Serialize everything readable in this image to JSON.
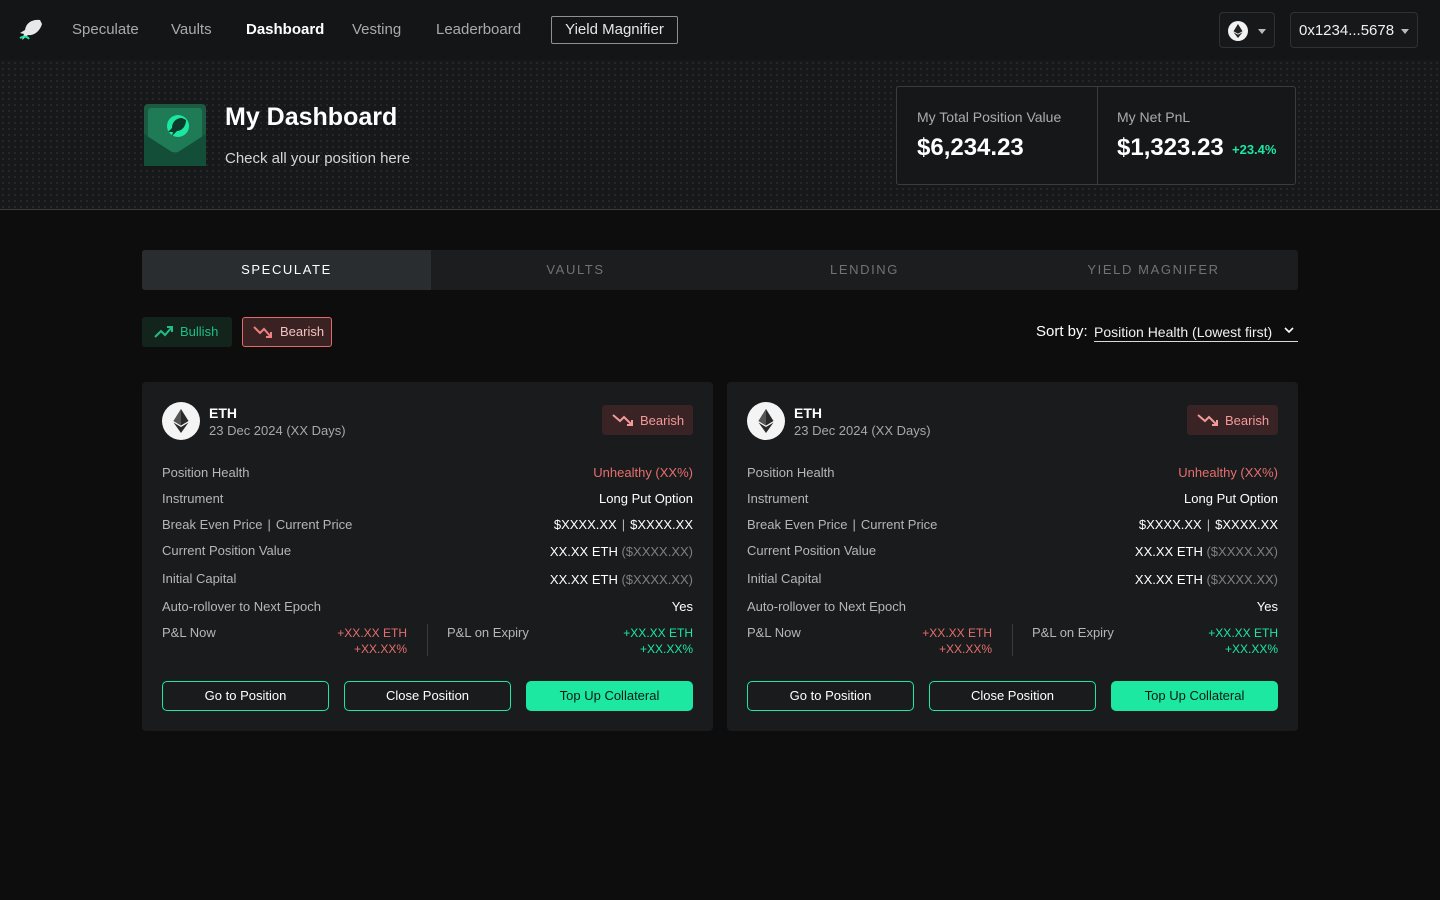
{
  "nav": {
    "links": [
      "Speculate",
      "Vaults",
      "Dashboard",
      "Vesting",
      "Leaderboard"
    ],
    "active": "Dashboard",
    "yield_button": "Yield Magnifier",
    "wallet_address": "0x1234...5678"
  },
  "header": {
    "title": "My Dashboard",
    "subtitle": "Check all your position here",
    "total_label": "My Total Position Value",
    "total_value": "$6,234.23",
    "pnl_label": "My Net PnL",
    "pnl_value": "$1,323.23",
    "pnl_change": "+23.4%"
  },
  "tabs": [
    "SPECULATE",
    "VAULTS",
    "LENDING",
    "YIELD MAGNIFER"
  ],
  "filters": {
    "bullish": "Bullish",
    "bearish": "Bearish"
  },
  "sort": {
    "label": "Sort by:",
    "value": "Position Health (Lowest first)"
  },
  "cards": [
    {
      "asset": "ETH",
      "expiry": "23 Dec 2024 (XX Days)",
      "badge": "Bearish",
      "health_label": "Position Health",
      "health_value": "Unhealthy (XX%)",
      "instrument_label": "Instrument",
      "instrument_value": "Long Put Option",
      "price_label_1": "Break Even Price",
      "price_label_2": "Current Price",
      "break_even": "$XXXX.XX",
      "current_price": "$XXXX.XX",
      "cpv_label": "Current Position Value",
      "cpv_eth": "XX.XX ETH",
      "cpv_usd": "($XXXX.XX)",
      "ic_label": "Initial Capital",
      "ic_eth": "XX.XX ETH",
      "ic_usd": "($XXXX.XX)",
      "rollover_label": "Auto-rollover to Next Epoch",
      "rollover_value": "Yes",
      "pnl_now_label": "P&L Now",
      "pnl_now_eth": "+XX.XX ETH",
      "pnl_now_pct": "+XX.XX%",
      "pnl_exp_label": "P&L on Expiry",
      "pnl_exp_eth": "+XX.XX ETH",
      "pnl_exp_pct": "+XX.XX%",
      "btn_go": "Go to Position",
      "btn_close": "Close Position",
      "btn_topup": "Top Up Collateral"
    },
    {
      "asset": "ETH",
      "expiry": "23 Dec 2024 (XX Days)",
      "badge": "Bearish",
      "health_label": "Position Health",
      "health_value": "Unhealthy (XX%)",
      "instrument_label": "Instrument",
      "instrument_value": "Long Put Option",
      "price_label_1": "Break Even Price",
      "price_label_2": "Current Price",
      "break_even": "$XXXX.XX",
      "current_price": "$XXXX.XX",
      "cpv_label": "Current Position Value",
      "cpv_eth": "XX.XX ETH",
      "cpv_usd": "($XXXX.XX)",
      "ic_label": "Initial Capital",
      "ic_eth": "XX.XX ETH",
      "ic_usd": "($XXXX.XX)",
      "rollover_label": "Auto-rollover to Next Epoch",
      "rollover_value": "Yes",
      "pnl_now_label": "P&L Now",
      "pnl_now_eth": "+XX.XX ETH",
      "pnl_now_pct": "+XX.XX%",
      "pnl_exp_label": "P&L on Expiry",
      "pnl_exp_eth": "+XX.XX ETH",
      "pnl_exp_pct": "+XX.XX%",
      "btn_go": "Go to Position",
      "btn_close": "Close Position",
      "btn_topup": "Top Up Collateral"
    }
  ],
  "colors": {
    "accent": "#1ce8a2",
    "bearish": "#e76e6e",
    "background": "#0d0d0d"
  }
}
